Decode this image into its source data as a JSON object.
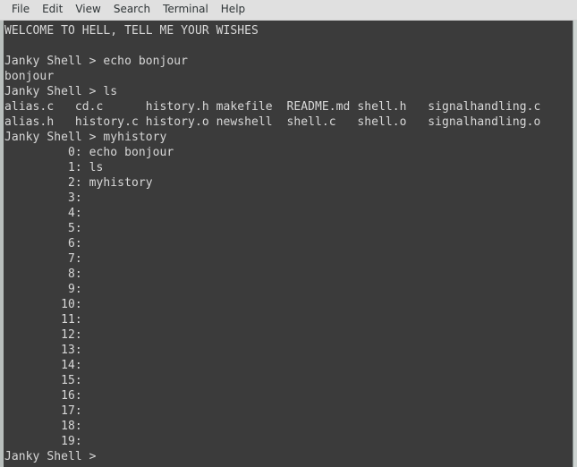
{
  "window": {
    "title": "Terminal",
    "background_color": "#3b3b3b",
    "text_color": "#d8d8d8",
    "menubar_color": "#e0e0e0"
  },
  "menubar": {
    "items": [
      {
        "label": "File"
      },
      {
        "label": "Edit"
      },
      {
        "label": "View"
      },
      {
        "label": "Search"
      },
      {
        "label": "Terminal"
      },
      {
        "label": "Help"
      }
    ]
  },
  "terminal": {
    "prompt": "Janky Shell > ",
    "banner": "WELCOME TO HELL, TELL ME YOUR WISHES",
    "lines": [
      "WELCOME TO HELL, TELL ME YOUR WISHES",
      "",
      "Janky Shell > echo bonjour",
      "bonjour",
      "Janky Shell > ls",
      "alias.c   cd.c      history.h makefile  README.md shell.h   signalhandling.c",
      "alias.h   history.c history.o newshell  shell.c   shell.o   signalhandling.o",
      "Janky Shell > myhistory",
      "         0: echo bonjour",
      "         1: ls",
      "         2: myhistory",
      "         3:",
      "         4:",
      "         5:",
      "         6:",
      "         7:",
      "         8:",
      "         9:",
      "        10:",
      "        11:",
      "        12:",
      "        13:",
      "        14:",
      "        15:",
      "        16:",
      "        17:",
      "        18:",
      "        19:",
      "Janky Shell > "
    ],
    "commands": [
      {
        "index": "0",
        "text": "echo bonjour"
      },
      {
        "index": "1",
        "text": "ls"
      },
      {
        "index": "2",
        "text": "myhistory"
      },
      {
        "index": "3",
        "text": ""
      },
      {
        "index": "4",
        "text": ""
      },
      {
        "index": "5",
        "text": ""
      },
      {
        "index": "6",
        "text": ""
      },
      {
        "index": "7",
        "text": ""
      },
      {
        "index": "8",
        "text": ""
      },
      {
        "index": "9",
        "text": ""
      },
      {
        "index": "10",
        "text": ""
      },
      {
        "index": "11",
        "text": ""
      },
      {
        "index": "12",
        "text": ""
      },
      {
        "index": "13",
        "text": ""
      },
      {
        "index": "14",
        "text": ""
      },
      {
        "index": "15",
        "text": ""
      },
      {
        "index": "16",
        "text": ""
      },
      {
        "index": "17",
        "text": ""
      },
      {
        "index": "18",
        "text": ""
      },
      {
        "index": "19",
        "text": ""
      }
    ],
    "ls_output": {
      "columns": 7,
      "row1": [
        "alias.c",
        "cd.c",
        "history.h",
        "makefile",
        "README.md",
        "shell.h",
        "signalhandling.c"
      ],
      "row2": [
        "alias.h",
        "history.c",
        "history.o",
        "newshell",
        "shell.c",
        "shell.o",
        "signalhandling.o"
      ]
    },
    "echo_command": "echo bonjour",
    "echo_output": "bonjour",
    "ls_command": "ls",
    "history_command": "myhistory"
  }
}
